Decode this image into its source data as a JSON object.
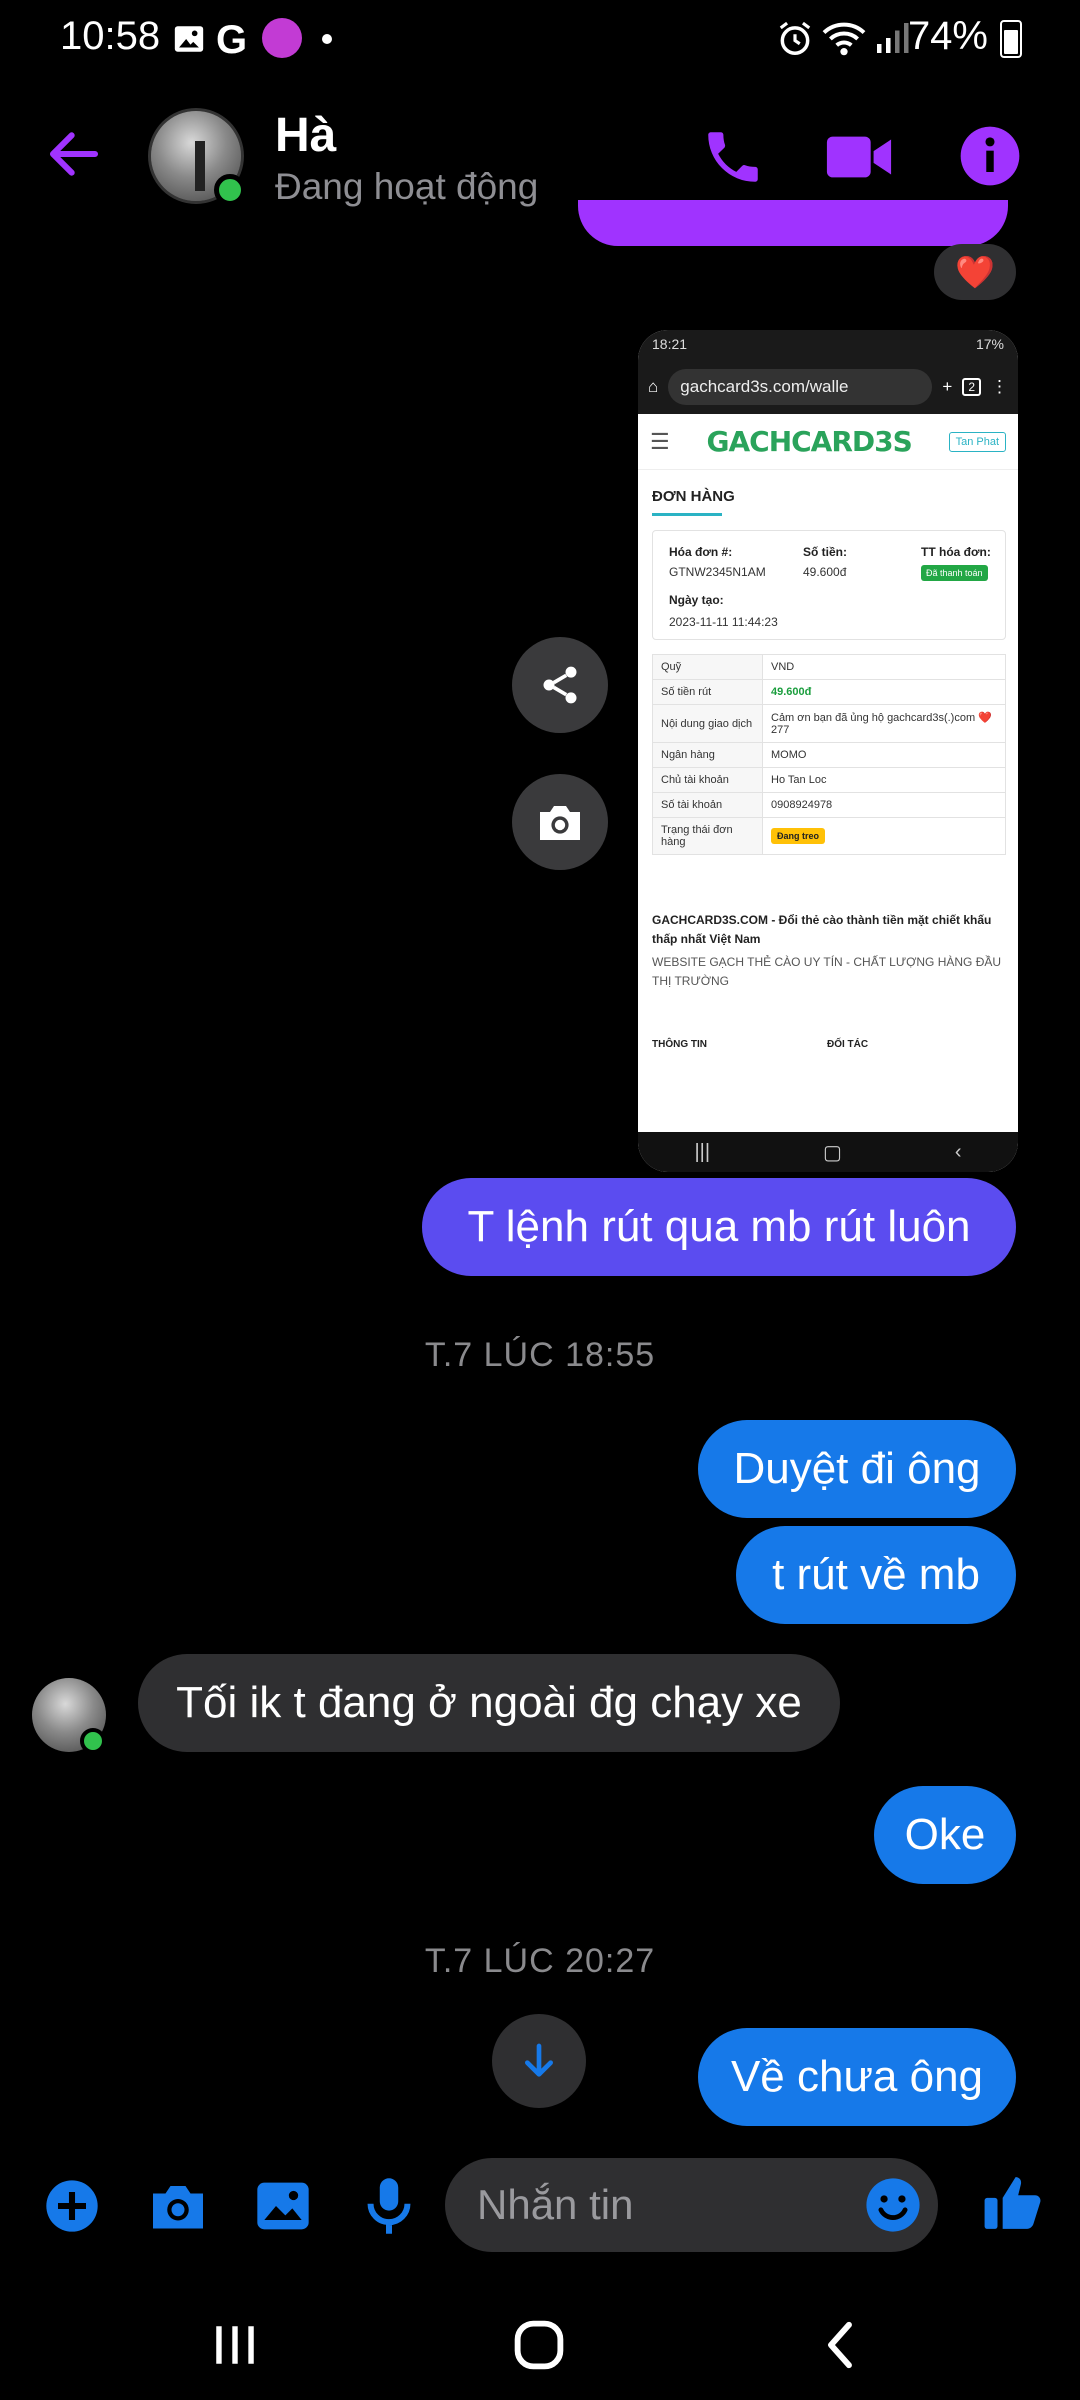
{
  "status_bar": {
    "time": "10:58",
    "battery": "74%"
  },
  "header": {
    "contact_name": "Hà",
    "contact_status": "Đang hoạt động"
  },
  "colors": {
    "accent": "#a033ff",
    "my_bubble_purple": "#5b4cf0",
    "my_bubble_blue": "#1679e9",
    "their_bubble": "#2f2f31",
    "online": "#31c24d"
  },
  "reaction": "❤️",
  "screenshot": {
    "status_time": "18:21",
    "status_battery": "17%",
    "url": "gachcard3s.com/walle",
    "tab_count": "2",
    "logo": "GACHCARD3S",
    "user_button": "Tan Phat",
    "section_title": "ĐƠN HÀNG",
    "invoice_label": "Hóa đơn #:",
    "invoice_value": "GTNW2345N1AM",
    "amount_label": "Số tiền:",
    "amount_value": "49.600đ",
    "invoice_status_label": "TT hóa đơn:",
    "invoice_status_value": "Đã thanh toán",
    "created_label": "Ngày tạo:",
    "created_value": "2023-11-11 11:44:23",
    "rows": [
      {
        "key": "Quỹ",
        "value": "VND"
      },
      {
        "key": "Số tiền rút",
        "value": "49.600đ"
      },
      {
        "key": "Nội dung giao dịch",
        "value": "Cảm ơn bạn đã ủng hộ gachcard3s(.)com ❤️277"
      },
      {
        "key": "Ngân hàng",
        "value": "MOMO"
      },
      {
        "key": "Chủ tài khoản",
        "value": "Ho Tan Loc"
      },
      {
        "key": "Số tài khoản",
        "value": "0908924978"
      },
      {
        "key": "Trạng thái đơn hàng",
        "value": "Đang treo"
      }
    ],
    "footer_title": "GACHCARD3S.COM - Đổi thẻ cào thành tiền mặt chiết khấu thấp nhất Việt Nam",
    "footer_sub": "WEBSITE GẠCH THẺ CÀO UY TÍN - CHẤT LƯỢNG HÀNG ĐẦU THỊ TRƯỜNG",
    "footer_col1": "THÔNG TIN",
    "footer_col2": "ĐỐI TÁC"
  },
  "messages": [
    {
      "text": "T lệnh rút qua mb  rút luôn"
    },
    {
      "text": "Duyệt đi ông"
    },
    {
      "text": "t rút về mb"
    },
    {
      "text": "Tối ik t đang ở ngoài đg chạy xe"
    },
    {
      "text": "Oke"
    },
    {
      "text": "Về chưa ông"
    }
  ],
  "dividers": [
    "T.7 LÚC 18:55",
    "T.7 LÚC 20:27"
  ],
  "composer": {
    "placeholder": "Nhắn tin"
  }
}
